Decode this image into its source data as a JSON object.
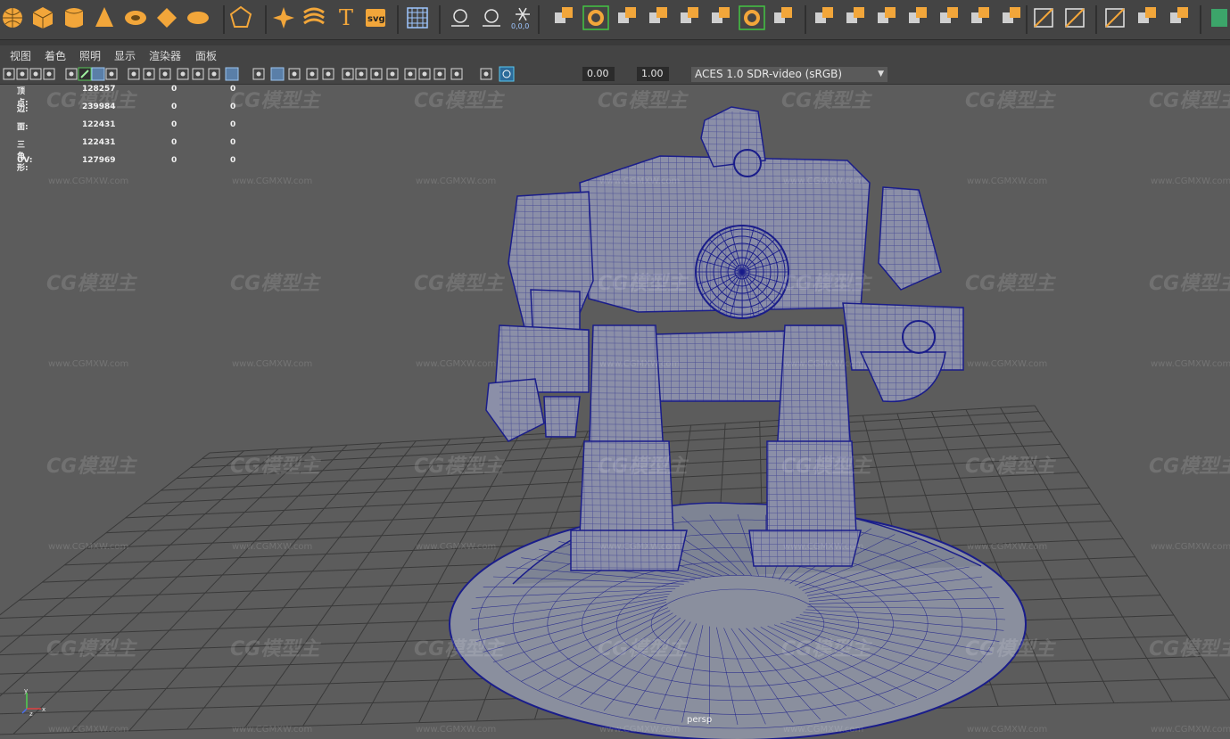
{
  "shelf": {
    "icons": [
      "sphere-icon",
      "cube-icon",
      "cylinder-icon",
      "cone-icon",
      "torus-icon",
      "plane-icon",
      "disc-icon",
      "platonic-icon",
      "sweep-icon",
      "twist-icon",
      "text-icon",
      "svg-icon",
      "uv-editor-icon",
      "locator-icon",
      "measure-icon",
      "snowflake-icon",
      "combine-icon",
      "extract-icon",
      "boolean-icon",
      "mirror-icon",
      "smooth-icon",
      "bevel-icon",
      "bridge-icon",
      "fill-hole-icon",
      "extrude-icon",
      "merge-icon",
      "insert-loop-icon",
      "multicut-icon",
      "offset-loop-icon",
      "slide-edge-icon",
      "target-weld-icon",
      "connect-icon",
      "collapse-icon",
      "crease-icon",
      "sculpt-icon",
      "lattice-icon",
      "soft-mod-icon"
    ],
    "svg_label": "svg",
    "text_label": "T",
    "snow_sub": "0,0,0"
  },
  "panel_menu": [
    "视图",
    "着色",
    "照明",
    "显示",
    "渲染器",
    "面板"
  ],
  "panel_toolbar": {
    "exposure": "0.00",
    "gamma": "1.00",
    "color_space": "ACES 1.0 SDR-video (sRGB)",
    "accent_color": "#5ac8f0"
  },
  "hud": {
    "rows": [
      {
        "label": "顶点:",
        "total": "128257",
        "selected": "0",
        "tri": "0"
      },
      {
        "label": "边:",
        "total": "239984",
        "selected": "0",
        "tri": "0"
      },
      {
        "label": "面:",
        "total": "122431",
        "selected": "0",
        "tri": "0"
      },
      {
        "label": "三角形:",
        "total": "122431",
        "selected": "0",
        "tri": "0"
      },
      {
        "label": "UV:",
        "total": "127969",
        "selected": "0",
        "tri": "0"
      }
    ]
  },
  "viewport": {
    "camera": "persp",
    "wireframe_color": "#1a1d8a",
    "grid_color": "#3a3a3a"
  },
  "watermark": {
    "brand": "CG模型主",
    "url": "www.CGMXW.com"
  },
  "axis": {
    "y": "y",
    "x": "x",
    "z": "z"
  }
}
